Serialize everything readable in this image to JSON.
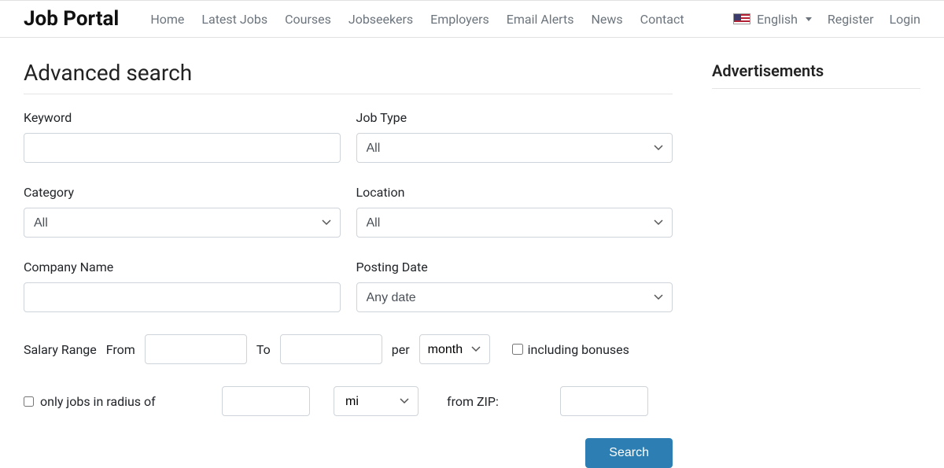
{
  "brand": "Job Portal",
  "nav": {
    "home": "Home",
    "latest_jobs": "Latest Jobs",
    "courses": "Courses",
    "jobseekers": "Jobseekers",
    "employers": "Employers",
    "email_alerts": "Email Alerts",
    "news": "News",
    "contact": "Contact",
    "language": "English",
    "register": "Register",
    "login": "Login"
  },
  "page": {
    "title": "Advanced search",
    "ads_title": "Advertisements"
  },
  "form": {
    "keyword_label": "Keyword",
    "jobtype_label": "Job Type",
    "jobtype_value": "All",
    "category_label": "Category",
    "category_value": "All",
    "location_label": "Location",
    "location_value": "All",
    "company_label": "Company Name",
    "posting_label": "Posting Date",
    "posting_value": "Any date",
    "salary_range_label": "Salary Range",
    "from_label": "From",
    "to_label": "To",
    "per_label": "per",
    "per_value": "month",
    "bonuses_label": "including bonuses",
    "radius_label": "only jobs in radius of",
    "radius_unit_value": "mi",
    "from_zip_label": "from ZIP:",
    "search_btn": "Search"
  }
}
